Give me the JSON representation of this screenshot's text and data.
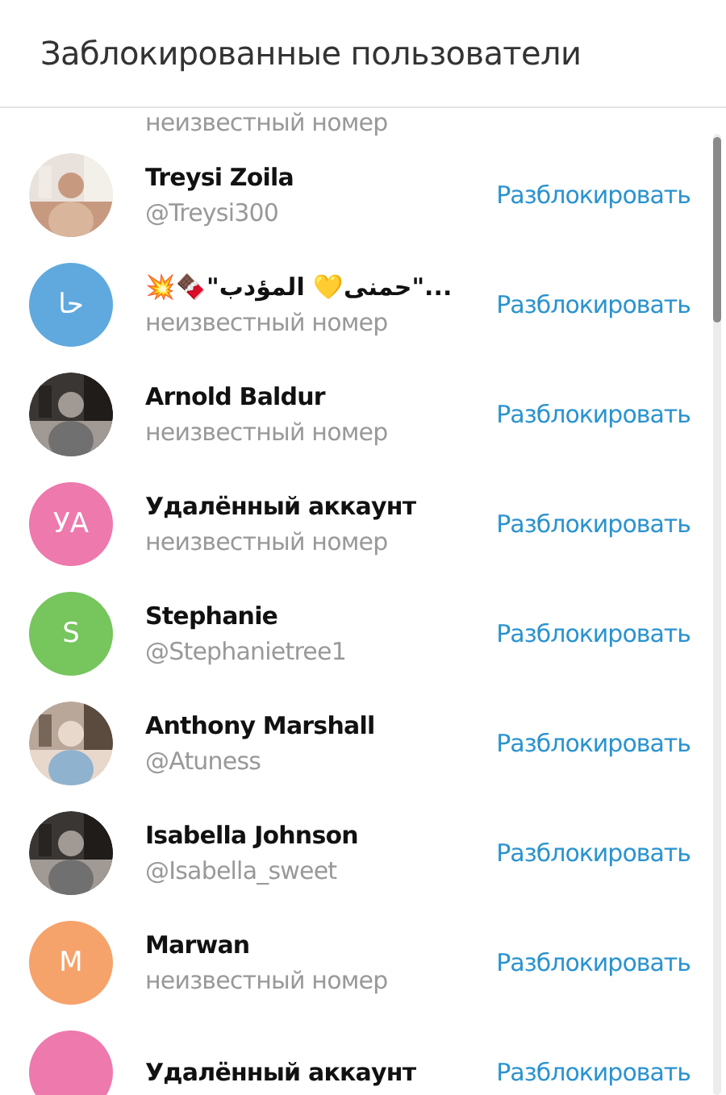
{
  "header": {
    "title": "Заблокированные пользователи"
  },
  "partial_top": {
    "subtitle": "неизвестный номер"
  },
  "users": [
    {
      "name": "Treysi Zoila",
      "subtitle": "@Treysi300",
      "action": "Разблокировать"
    },
    {
      "name": "💥🍫\"حمنى💛 المؤدب\"...",
      "subtitle": "неизвестный номер",
      "avatar": {
        "kind": "initials",
        "initials": "حا",
        "color": "#5fa9de"
      },
      "action": "Разблокировать"
    },
    {
      "name": "Arnold Baldur",
      "subtitle": "неизвестный номер",
      "action": "Разблокировать"
    },
    {
      "name": "Удалённый аккаунт",
      "subtitle": "неизвестный номер",
      "avatar": {
        "kind": "initials",
        "initials": "УА",
        "color": "#ed79ad"
      },
      "action": "Разблокировать"
    },
    {
      "name": "Stephanie",
      "subtitle": "@Stephanietree1",
      "avatar": {
        "kind": "initials",
        "initials": "S",
        "color": "#76c55d"
      },
      "action": "Разблокировать"
    },
    {
      "name": "Anthony Marshall",
      "subtitle": "@Atuness",
      "action": "Разблокировать"
    },
    {
      "name": "Isabella Johnson",
      "subtitle": "@Isabella_sweet",
      "action": "Разблокировать"
    },
    {
      "name": "Marwan",
      "subtitle": "неизвестный номер",
      "avatar": {
        "kind": "initials",
        "initials": "M",
        "color": "#f6a26b"
      },
      "action": "Разблокировать"
    },
    {
      "name": "Удалённый аккаунт",
      "avatar": {
        "kind": "initials",
        "color": "#ed79ad"
      },
      "action": "Разблокировать"
    }
  ]
}
